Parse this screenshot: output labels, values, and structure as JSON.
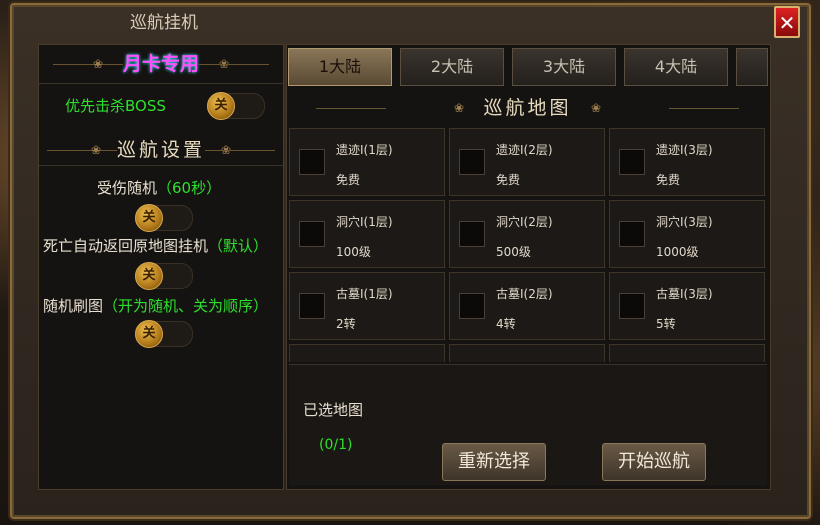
{
  "window": {
    "title": "巡航挂机",
    "close_label": "✕"
  },
  "left": {
    "month_card": "月卡专用",
    "boss_label": "优先击杀BOSS",
    "boss_toggle": "关",
    "section_title": "巡航设置",
    "settings": [
      {
        "label": "受伤随机",
        "hint": "（60秒）",
        "toggle": "关"
      },
      {
        "label": "死亡自动返回原地图挂机",
        "hint": "（默认）",
        "toggle": "关"
      },
      {
        "label": "随机刷图",
        "hint": "（开为随机、关为顺序）",
        "toggle": "关"
      }
    ]
  },
  "tabs": [
    {
      "label": "1大陆",
      "active": true
    },
    {
      "label": "2大陆",
      "active": false
    },
    {
      "label": "3大陆",
      "active": false
    },
    {
      "label": "4大陆",
      "active": false
    }
  ],
  "map": {
    "title": "巡航地图",
    "cells": [
      {
        "name": "遗迹Ⅰ(1层)",
        "req": "免费"
      },
      {
        "name": "遗迹Ⅰ(2层)",
        "req": "免费"
      },
      {
        "name": "遗迹Ⅰ(3层)",
        "req": "免费"
      },
      {
        "name": "洞穴Ⅰ(1层)",
        "req": "100级"
      },
      {
        "name": "洞穴Ⅰ(2层)",
        "req": "500级"
      },
      {
        "name": "洞穴Ⅰ(3层)",
        "req": "1000级"
      },
      {
        "name": "古墓Ⅰ(1层)",
        "req": "2转"
      },
      {
        "name": "古墓Ⅰ(2层)",
        "req": "4转"
      },
      {
        "name": "古墓Ⅰ(3层)",
        "req": "5转"
      }
    ]
  },
  "selection": {
    "label": "已选地图",
    "count": "(0/1)",
    "reselect_button": "重新选择",
    "start_button": "开始巡航"
  }
}
